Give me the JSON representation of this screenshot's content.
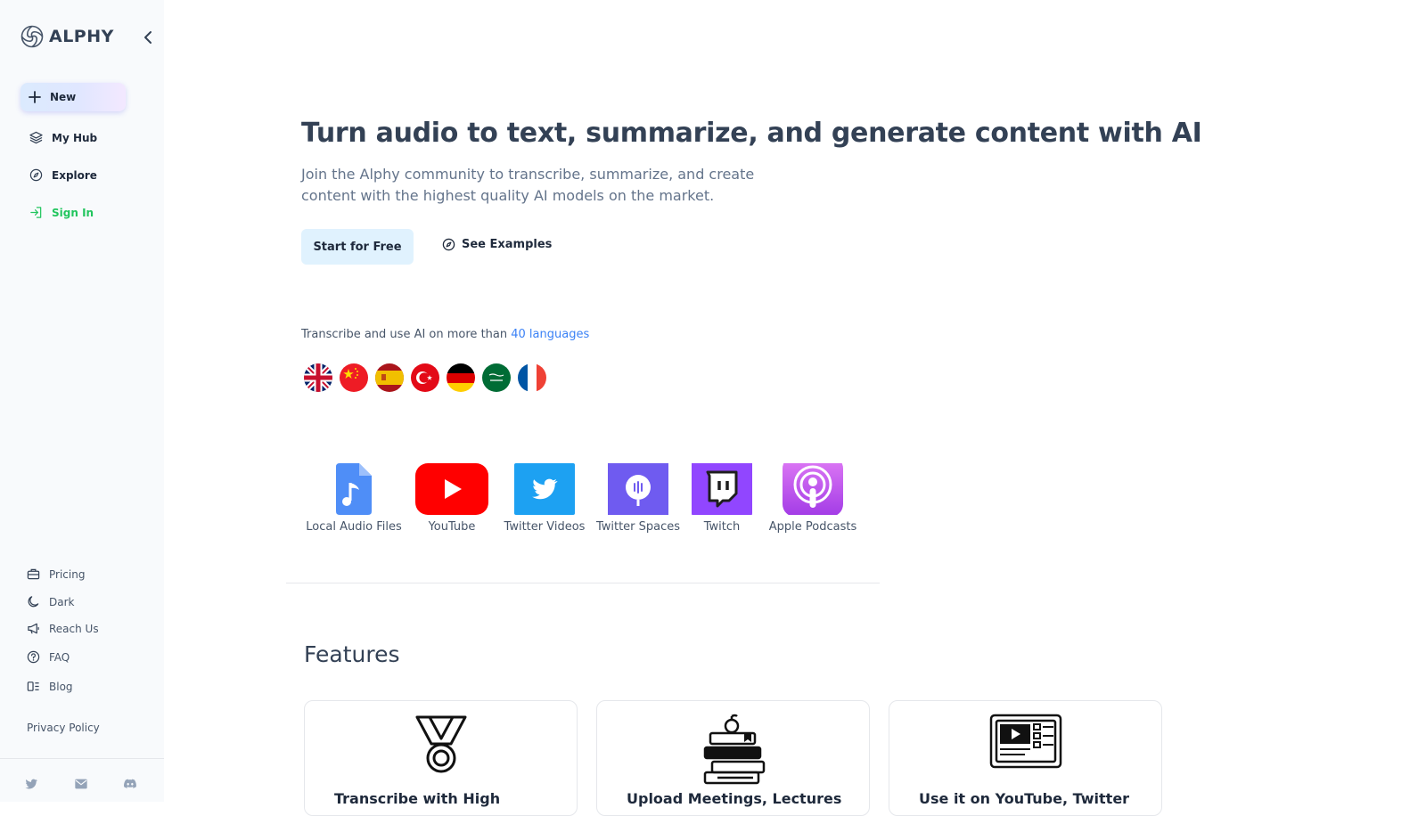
{
  "sidebar": {
    "logo_text": "ALPHY",
    "new_label": "New",
    "nav": [
      {
        "label": "My Hub",
        "icon": "layers-icon"
      },
      {
        "label": "Explore",
        "icon": "compass-icon"
      },
      {
        "label": "Sign In",
        "icon": "sign-in-icon"
      }
    ],
    "bottom": [
      {
        "label": "Pricing",
        "icon": "briefcase-icon"
      },
      {
        "label": "Dark",
        "icon": "moon-icon"
      },
      {
        "label": "Reach Us",
        "icon": "megaphone-icon"
      },
      {
        "label": "FAQ",
        "icon": "question-icon"
      },
      {
        "label": "Blog",
        "icon": "blog-icon"
      }
    ],
    "privacy": "Privacy Policy",
    "socials": [
      "twitter-icon",
      "mail-icon",
      "discord-icon"
    ]
  },
  "hero": {
    "title": "Turn audio to text, summarize, and generate content with AI",
    "subtitle": "Join the Alphy community to transcribe, summarize, and create content with the highest quality AI models on the market.",
    "start_label": "Start for Free",
    "examples_label": "See Examples"
  },
  "languages": {
    "prefix": "Transcribe and use AI on more than ",
    "link": "40 languages",
    "flags": [
      "uk-flag",
      "china-flag",
      "spain-flag",
      "turkey-flag",
      "germany-flag",
      "saudi-flag",
      "france-flag"
    ]
  },
  "sources": [
    {
      "label": "Local Audio Files",
      "icon": "audio-file-icon"
    },
    {
      "label": "YouTube",
      "icon": "youtube-icon"
    },
    {
      "label": "Twitter Videos",
      "icon": "twitter-icon"
    },
    {
      "label": "Twitter Spaces",
      "icon": "twitter-spaces-icon"
    },
    {
      "label": "Twitch",
      "icon": "twitch-icon"
    },
    {
      "label": "Apple Podcasts",
      "icon": "podcasts-icon"
    }
  ],
  "features": {
    "title": "Features",
    "cards": [
      {
        "title": "Transcribe with High",
        "icon": "medal-icon"
      },
      {
        "title": "Upload Meetings, Lectures",
        "icon": "books-icon"
      },
      {
        "title": "Use it on YouTube, Twitter",
        "icon": "video-browser-icon"
      }
    ]
  }
}
